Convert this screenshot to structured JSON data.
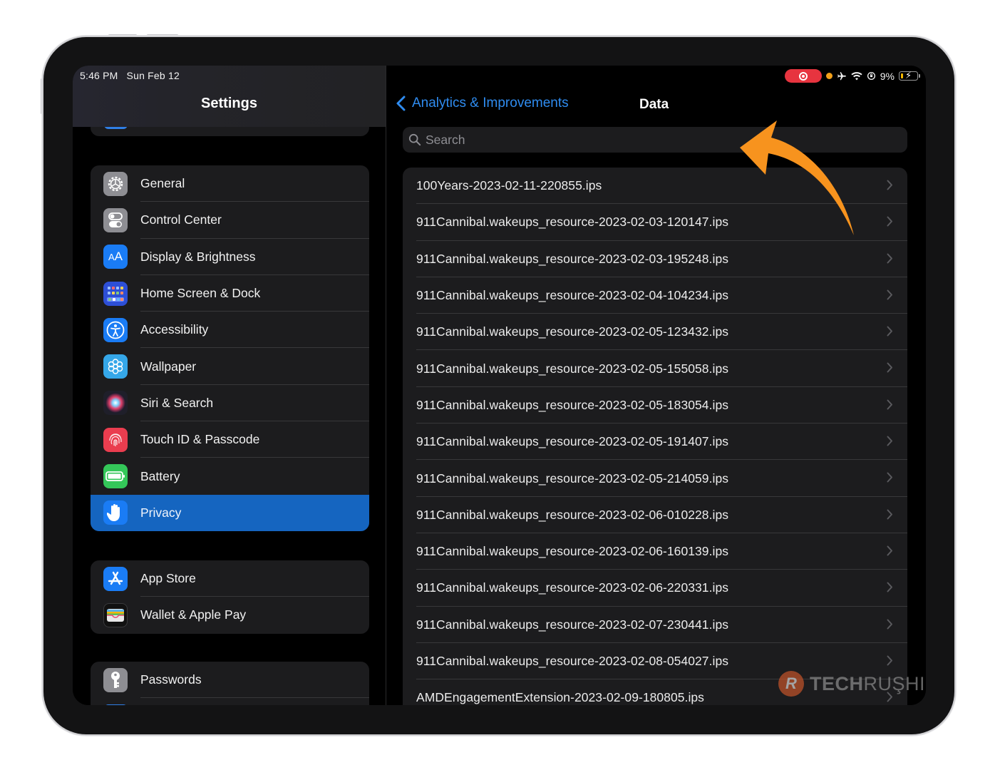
{
  "status_bar": {
    "time": "5:46 PM",
    "date": "Sun Feb 12",
    "battery_percent": "9%",
    "icons": [
      "screen-record-icon",
      "mic-indicator-dot",
      "airplane-icon",
      "wifi-icon",
      "orientation-lock-icon",
      "battery-charging-icon"
    ]
  },
  "sidebar": {
    "title": "Settings",
    "groups": [
      {
        "items": [
          {
            "label": "General",
            "icon": "gear-icon",
            "color": "#8e8e93"
          },
          {
            "label": "Control Center",
            "icon": "toggles-icon",
            "color": "#8e8e93"
          },
          {
            "label": "Display & Brightness",
            "icon": "text-size-icon",
            "color": "#1a7cf5"
          },
          {
            "label": "Home Screen & Dock",
            "icon": "app-grid-icon",
            "color": "#2d4fd6"
          },
          {
            "label": "Accessibility",
            "icon": "accessibility-icon",
            "color": "#1a7cf5"
          },
          {
            "label": "Wallpaper",
            "icon": "flower-icon",
            "color": "#35a7e9"
          },
          {
            "label": "Siri & Search",
            "icon": "siri-icon",
            "color": "#1f1f2a"
          },
          {
            "label": "Touch ID & Passcode",
            "icon": "fingerprint-icon",
            "color": "#ea3d4f"
          },
          {
            "label": "Battery",
            "icon": "battery-icon",
            "color": "#34c759"
          },
          {
            "label": "Privacy",
            "icon": "hand-icon",
            "color": "#1a7cf5",
            "selected": true
          }
        ]
      },
      {
        "items": [
          {
            "label": "App Store",
            "icon": "app-store-icon",
            "color": "#1a7cf5"
          },
          {
            "label": "Wallet & Apple Pay",
            "icon": "wallet-icon",
            "color": "#111111"
          }
        ]
      },
      {
        "items": [
          {
            "label": "Passwords",
            "icon": "key-icon",
            "color": "#8e8e93"
          }
        ]
      }
    ]
  },
  "detail": {
    "back_label": "Analytics & Improvements",
    "title": "Data",
    "search_placeholder": "Search",
    "files": [
      "100Years-2023-02-11-220855.ips",
      "911Cannibal.wakeups_resource-2023-02-03-120147.ips",
      "911Cannibal.wakeups_resource-2023-02-03-195248.ips",
      "911Cannibal.wakeups_resource-2023-02-04-104234.ips",
      "911Cannibal.wakeups_resource-2023-02-05-123432.ips",
      "911Cannibal.wakeups_resource-2023-02-05-155058.ips",
      "911Cannibal.wakeups_resource-2023-02-05-183054.ips",
      "911Cannibal.wakeups_resource-2023-02-05-191407.ips",
      "911Cannibal.wakeups_resource-2023-02-05-214059.ips",
      "911Cannibal.wakeups_resource-2023-02-06-010228.ips",
      "911Cannibal.wakeups_resource-2023-02-06-160139.ips",
      "911Cannibal.wakeups_resource-2023-02-06-220331.ips",
      "911Cannibal.wakeups_resource-2023-02-07-230441.ips",
      "911Cannibal.wakeups_resource-2023-02-08-054027.ips",
      "AMDEngagementExtension-2023-02-09-180805.ips"
    ]
  },
  "annotation": {
    "arrow_color": "#f7931e",
    "points_to": "search-field"
  },
  "watermark": {
    "bold": "TECH",
    "light": "RUŞHI",
    "logo_letter": "R"
  },
  "colors": {
    "accent": "#2f8cf0",
    "selected_row": "#1565c0",
    "group_bg": "#1c1c1e",
    "separator": "#38383a"
  }
}
